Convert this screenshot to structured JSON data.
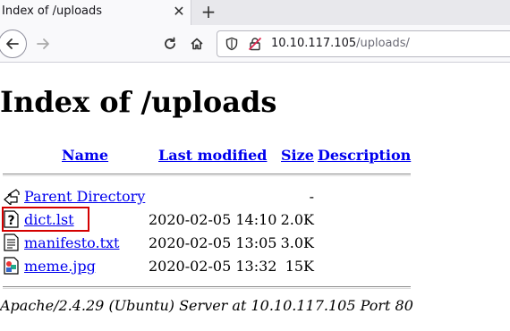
{
  "browser": {
    "tab_title": "Index of /uploads",
    "tab_close": "✕",
    "new_tab": "+",
    "url_host": "10.10.117.105",
    "url_path": "/uploads/"
  },
  "page": {
    "heading": "Index of /uploads",
    "columns": {
      "name": "Name",
      "last_modified": "Last modified",
      "size": "Size",
      "description": "Description"
    },
    "rows": [
      {
        "name": "Parent Directory",
        "date": "",
        "size": "-",
        "icon": "back-folder-icon"
      },
      {
        "name": "dict.lst",
        "date": "2020-02-05 14:10",
        "size": "2.0K",
        "icon": "unknown-file-icon"
      },
      {
        "name": "manifesto.txt",
        "date": "2020-02-05 13:05",
        "size": "3.0K",
        "icon": "text-file-icon"
      },
      {
        "name": "meme.jpg",
        "date": "2020-02-05 13:32",
        "size": "15K",
        "icon": "image-file-icon"
      }
    ],
    "footer": "Apache/2.4.29 (Ubuntu) Server at 10.10.117.105 Port 80"
  },
  "colors": {
    "link": "#0000ee",
    "highlight": "#d40000",
    "chrome": "#f9f9fb"
  }
}
